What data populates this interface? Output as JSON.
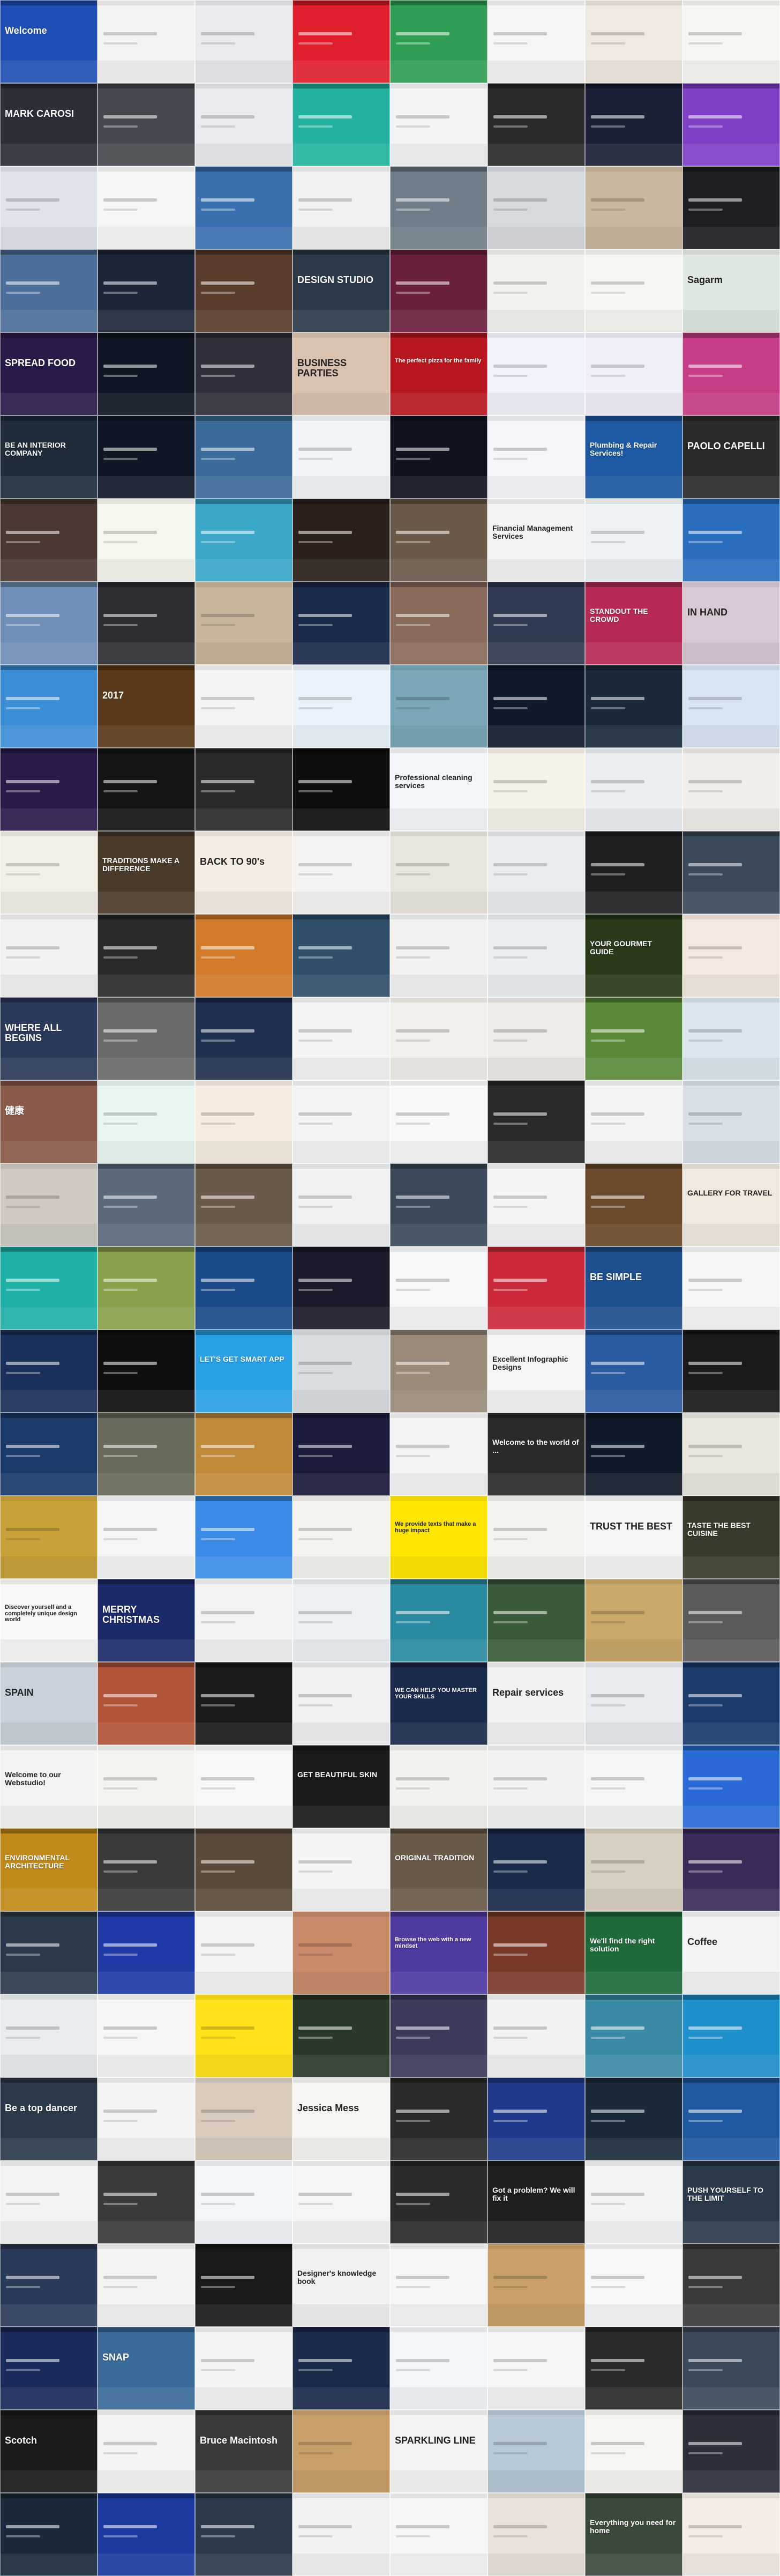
{
  "screenshot": {
    "grid": {
      "columns": 8,
      "rows": 31
    },
    "texts": [
      {
        "row": 0,
        "col": 0,
        "text": "Welcome"
      },
      {
        "row": 1,
        "col": 0,
        "text": "MARK CAROSI"
      },
      {
        "row": 3,
        "col": 3,
        "text": "DESIGN STUDIO"
      },
      {
        "row": 3,
        "col": 7,
        "text": "Sagarm"
      },
      {
        "row": 4,
        "col": 0,
        "text": "SPREAD FOOD"
      },
      {
        "row": 4,
        "col": 3,
        "text": "BUSINESS PARTIES"
      },
      {
        "row": 4,
        "col": 4,
        "text": "The perfect pizza for the family"
      },
      {
        "row": 5,
        "col": 0,
        "text": "BE AN INTERIOR COMPANY"
      },
      {
        "row": 5,
        "col": 6,
        "text": "Plumbing & Repair Services!"
      },
      {
        "row": 5,
        "col": 7,
        "text": "PAOLO CAPELLI"
      },
      {
        "row": 6,
        "col": 5,
        "text": "Financial Management Services"
      },
      {
        "row": 7,
        "col": 6,
        "text": "STANDOUT THE CROWD"
      },
      {
        "row": 7,
        "col": 7,
        "text": "IN HAND"
      },
      {
        "row": 8,
        "col": 1,
        "text": "2017"
      },
      {
        "row": 9,
        "col": 4,
        "text": "Professional cleaning services"
      },
      {
        "row": 10,
        "col": 1,
        "text": "TRADITIONS MAKE A DIFFERENCE"
      },
      {
        "row": 10,
        "col": 2,
        "text": "BACK TO 90's"
      },
      {
        "row": 11,
        "col": 6,
        "text": "YOUR GOURMET GUIDE"
      },
      {
        "row": 12,
        "col": 0,
        "text": "WHERE ALL BEGINS"
      },
      {
        "row": 13,
        "col": 0,
        "text": "健康"
      },
      {
        "row": 14,
        "col": 7,
        "text": "GALLERY FOR TRAVEL"
      },
      {
        "row": 15,
        "col": 6,
        "text": "BE SIMPLE"
      },
      {
        "row": 16,
        "col": 2,
        "text": "LET'S GET SMART APP"
      },
      {
        "row": 16,
        "col": 5,
        "text": "Excellent Infographic Designs"
      },
      {
        "row": 17,
        "col": 5,
        "text": "Welcome to the world of ..."
      },
      {
        "row": 18,
        "col": 4,
        "text": "We provide texts that make a huge impact"
      },
      {
        "row": 18,
        "col": 6,
        "text": "TRUST THE BEST"
      },
      {
        "row": 18,
        "col": 7,
        "text": "TASTE THE BEST CUISINE"
      },
      {
        "row": 19,
        "col": 0,
        "text": "Discover yourself and a completely unique design world"
      },
      {
        "row": 19,
        "col": 1,
        "text": "MERRY CHRISTMAS"
      },
      {
        "row": 20,
        "col": 0,
        "text": "SPAIN"
      },
      {
        "row": 20,
        "col": 4,
        "text": "WE CAN HELP YOU MASTER YOUR SKILLS"
      },
      {
        "row": 20,
        "col": 5,
        "text": "Repair services"
      },
      {
        "row": 21,
        "col": 0,
        "text": "Welcome to our Webstudio!"
      },
      {
        "row": 21,
        "col": 3,
        "text": "GET BEAUTIFUL SKIN"
      },
      {
        "row": 22,
        "col": 0,
        "text": "ENVIRONMENTAL ARCHITECTURE"
      },
      {
        "row": 22,
        "col": 4,
        "text": "ORIGINAL TRADITION"
      },
      {
        "row": 23,
        "col": 4,
        "text": "Browse the web with a new mindset"
      },
      {
        "row": 23,
        "col": 6,
        "text": "We'll find the right solution"
      },
      {
        "row": 23,
        "col": 7,
        "text": "Coffee"
      },
      {
        "row": 25,
        "col": 3,
        "text": "Jessica Mess"
      },
      {
        "row": 25,
        "col": 0,
        "text": "Be a top dancer"
      },
      {
        "row": 26,
        "col": 5,
        "text": "Got a problem? We will fix it"
      },
      {
        "row": 26,
        "col": 7,
        "text": "PUSH YOURSELF TO THE LIMIT"
      },
      {
        "row": 27,
        "col": 3,
        "text": "Designer's knowledge book"
      },
      {
        "row": 28,
        "col": 1,
        "text": "SNAP"
      },
      {
        "row": 29,
        "col": 0,
        "text": "Scotch"
      },
      {
        "row": 29,
        "col": 2,
        "text": "Bruce Macintosh"
      },
      {
        "row": 29,
        "col": 4,
        "text": "SPARKLING LINE"
      },
      {
        "row": 30,
        "col": 6,
        "text": "Everything you need for home"
      }
    ]
  },
  "palette": {
    "row0": [
      "#1f4fb5",
      "#f3f3f3",
      "#e9e9ee",
      "#e01f2c",
      "#2f9e54",
      "#f5f5f5",
      "#efe8e0",
      "#f8f6f2"
    ],
    "row1": [
      "#2a2f38",
      "#46494f",
      "#e9eaee",
      "#24b3a0",
      "#f2f4f6",
      "#2a2a2a",
      "#1b2036",
      "#7f3fc7"
    ],
    "row2": [
      "#dfe4ea",
      "#f6f6f6",
      "#3a6fb0",
      "#f1f1f1",
      "#6e7d88",
      "#d6d9de",
      "#c9b8a0",
      "#1d1d22"
    ],
    "row3": [
      "#4c6f9a",
      "#1d2638",
      "#5a3c2c",
      "#2b3a4a",
      "#6a1f3f",
      "#f4f2ee",
      "#f7f7f2",
      "#dfe8e0"
    ],
    "row4": [
      "#2a1a4a",
      "#0f1522",
      "#2e2f3a",
      "#d9c2b0",
      "#b8171f",
      "#f0f4fa",
      "#f2eef8",
      "#c53d86"
    ],
    "row5": [
      "#1e2c3a",
      "#101826",
      "#3a6a9a",
      "#f2f5f8",
      "#0f1320",
      "#f4f6f9",
      "#1d5aa3",
      "#2b2b2b"
    ],
    "row6": [
      "#4a3830",
      "#f5f7ef",
      "#3aa7c9",
      "#2a1f1a",
      "#6b5a4a",
      "#f3f3f3",
      "#eef2f5",
      "#2a6fbf"
    ],
    "row7": [
      "#6f8fb8",
      "#2c2e33",
      "#c9b59a",
      "#1a2a4a",
      "#8a6a5a",
      "#2f3b52",
      "#b72a55",
      "#d9c9d6"
    ],
    "row8": [
      "#3c8fd6",
      "#5a3a1a",
      "#f4f4f4",
      "#eaf3fb",
      "#7aa8b8",
      "#0f1a2a",
      "#1a2a3a",
      "#d8e6f2"
    ],
    "row9": [
      "#2a1a4a",
      "#141414",
      "#2a2a2a",
      "#0d0d0d",
      "#f3f6fa",
      "#f7f2e6",
      "#eaeef2",
      "#f1ede8"
    ],
    "row10": [
      "#f3efe8",
      "#4a3a2a",
      "#f5ede2",
      "#f6f4f2",
      "#eae4de",
      "#e9ecef",
      "#1f1f22",
      "#3a4a5a"
    ],
    "row11": [
      "#f4f2f0",
      "#2a2a2a",
      "#d17a2a",
      "#2f4f6a",
      "#f2f2f2",
      "#ebeff4",
      "#2a3a1a",
      "#f3e9df"
    ],
    "row12": [
      "#2a3a5a",
      "#6a6a6a",
      "#1f2f4f",
      "#f4f4f4",
      "#f2efea",
      "#eeeae6",
      "#5a8a3a",
      "#dbe6ee"
    ],
    "row13": [
      "#8a5a4a",
      "#e8f6f2",
      "#f6ece0",
      "#f4f4f4",
      "#f8f8f8",
      "#2a2a2a",
      "#f2f4f6",
      "#d9dfe6"
    ],
    "row14": [
      "#cfc9c2",
      "#5a6a7a",
      "#6a5a4a",
      "#f0f1f3",
      "#3a4a5a",
      "#f4f4f4",
      "#6a4a2a",
      "#efe8dd"
    ],
    "row15": [
      "#1fb0a8",
      "#8aa04a",
      "#1a4a8a",
      "#1a1a2a",
      "#f6f7f8",
      "#cc2a3a",
      "#1e4f8f",
      "#f4f6f8"
    ],
    "row16": [
      "#1a2f5a",
      "#0f0f0f",
      "#2aa0e6",
      "#d9dde2",
      "#9a8a7a",
      "#f5f5f5",
      "#2a5aa0",
      "#1a1a1a"
    ],
    "row17": [
      "#1a3a6a",
      "#6a6a5a",
      "#c08a3a",
      "#1a1a3a",
      "#f4f4f4",
      "#2a2a2a",
      "#0f1a2a",
      "#e9e6e0"
    ],
    "row18": [
      "#c9a23a",
      "#f3f5f7",
      "#3a8ae6",
      "#f5f3ef",
      "#ffe600",
      "#f4f3ef",
      "#f5f5f5",
      "#3a3a2a"
    ],
    "row19": [
      "#f8f8f8",
      "#1a2a6a",
      "#f3f3f3",
      "#eef1f4",
      "#2a8aa0",
      "#3a5a3a",
      "#c9a86a",
      "#5a5a5a"
    ],
    "row20": [
      "#c9d2da",
      "#b2543a",
      "#1a1a1a",
      "#f0f1f3",
      "#1a2a4a",
      "#f2f2f2",
      "#e7eaee",
      "#1a3a6a"
    ],
    "row21": [
      "#f4f4f4",
      "#f5f3ef",
      "#f7f7f7",
      "#1a1a1a",
      "#f4f2ee",
      "#f2f2f2",
      "#f3f5f7",
      "#2a6ad6"
    ],
    "row22": [
      "#c28a1a",
      "#3a3a3a",
      "#5a4a3a",
      "#f4f4f4",
      "#6a5a4a",
      "#1a2a4a",
      "#d7cfbf",
      "#3a2a5a"
    ],
    "row23": [
      "#2a3a4a",
      "#1f3aa6",
      "#f4f4f4",
      "#c98a6a",
      "#4f3aa0",
      "#7a3a2a",
      "#1f6a3a",
      "#f2f4f6"
    ],
    "row24": [
      "#e9ecef",
      "#f5f5f5",
      "#ffe21a",
      "#2a3a2a",
      "#3a3a5a",
      "#f2f2f2",
      "#3a8aa6",
      "#1f8fc9"
    ],
    "row25": [
      "#2a3a4a",
      "#f4f4f4",
      "#d9ccbd",
      "#f7f5f2",
      "#2a2a2a",
      "#1f3a8a",
      "#1a2a3a",
      "#1f5aa0"
    ],
    "row26": [
      "#f4f4f4",
      "#3a3a3a",
      "#f2f6fa",
      "#f5f5f5",
      "#2a2a2a",
      "#1f1f1f",
      "#f2f4f6",
      "#2a3a4a"
    ],
    "row27": [
      "#2a3a5a",
      "#f4f4f4",
      "#1a1a1a",
      "#f3f1ef",
      "#f6f6f6",
      "#c9a06a",
      "#f5f7f9",
      "#3a3a3a"
    ],
    "row28": [
      "#1a2a5a",
      "#3a6a9a",
      "#f4f4f4",
      "#1a2a4a",
      "#f3f6f9",
      "#f5f5f5",
      "#2a2a2a",
      "#3a4a5a"
    ],
    "row29": [
      "#1a1a1a",
      "#f4f4f4",
      "#3a3a3a",
      "#c9a06a",
      "#f4f4f4",
      "#b7c9d6",
      "#f7f5f1",
      "#2a2f3a"
    ],
    "row30": [
      "#1a2a3a",
      "#1a3aa0",
      "#2a3a4a",
      "#f2f2f2",
      "#f4f6f8",
      "#e8e2da",
      "#3a4a3a",
      "#f4ede6"
    ]
  }
}
